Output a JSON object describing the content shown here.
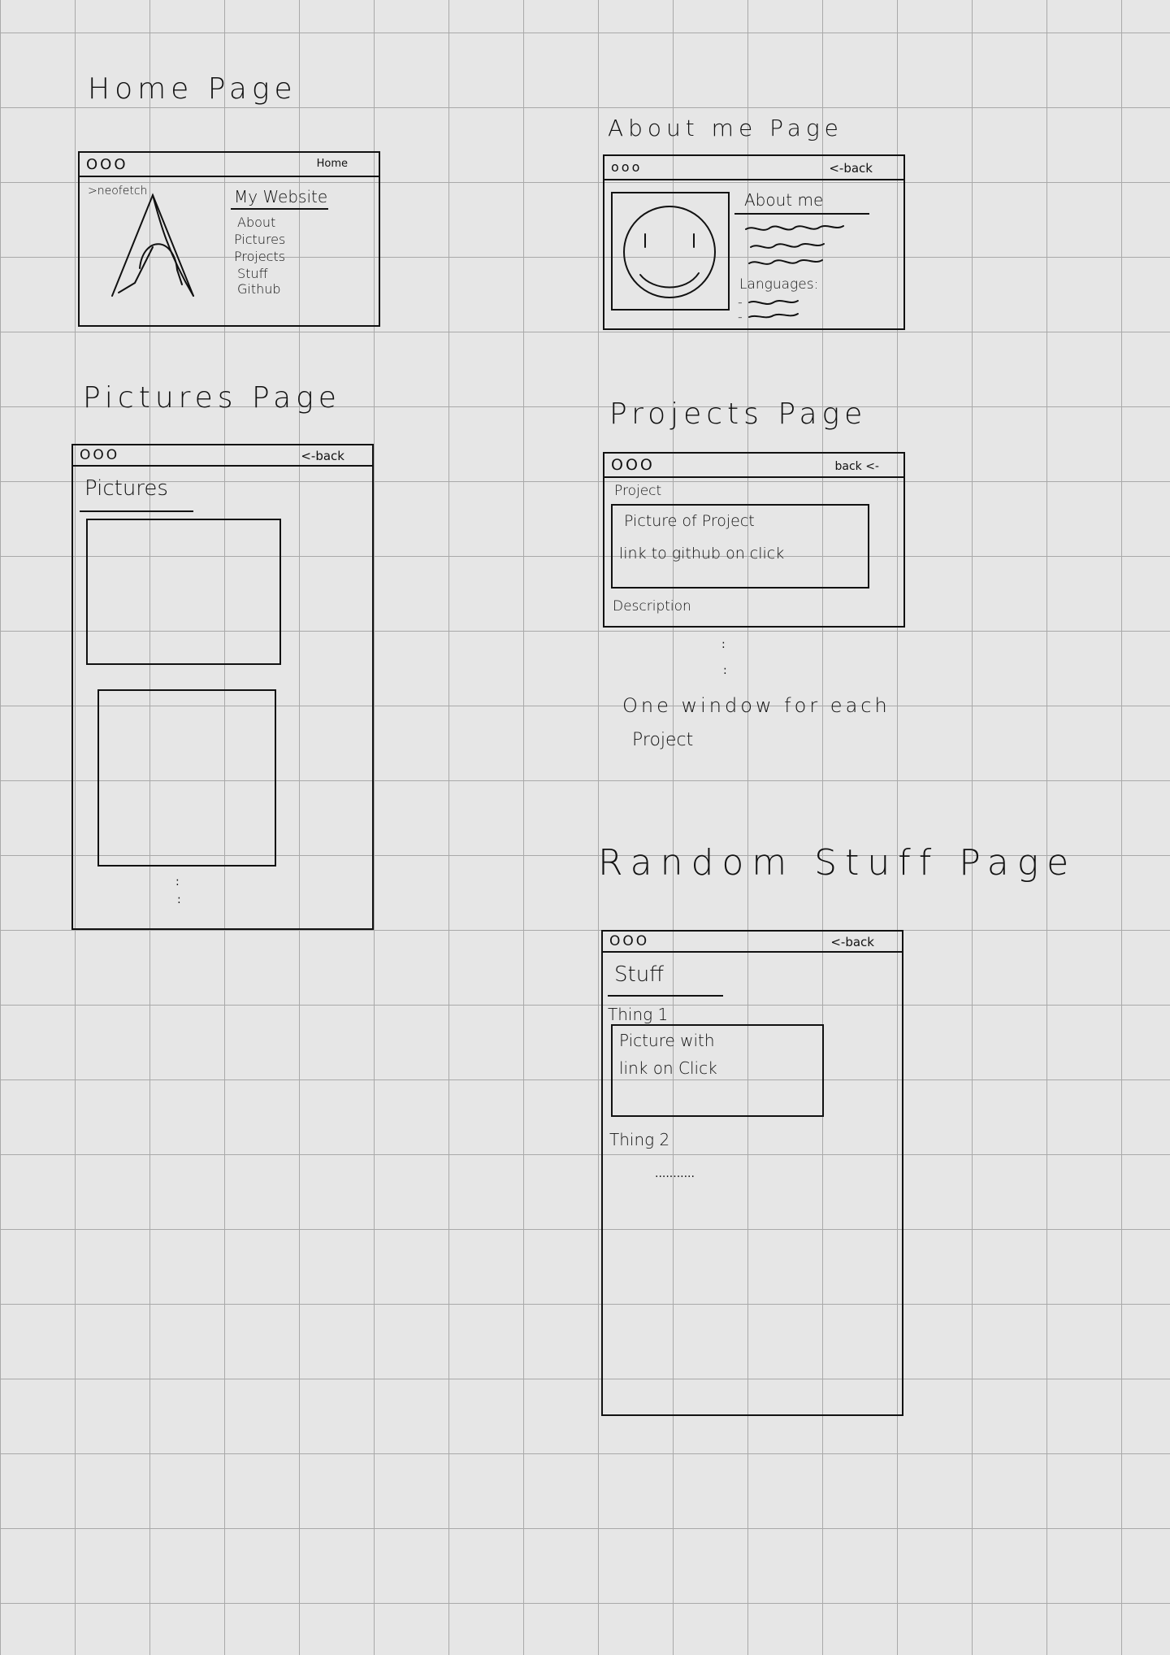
{
  "home": {
    "title": "Home Page",
    "dots": "OOO",
    "bar_label": "Home",
    "terminal": ">neofetch",
    "heading": "My Website",
    "links": [
      "About",
      "Pictures",
      "Projects",
      "Stuff",
      "Github"
    ]
  },
  "about": {
    "title": "About me Page",
    "dots": "ooo",
    "bar_label": "<-back",
    "heading": "About me",
    "languages_label": "Languages:",
    "bullets": [
      "-",
      "-"
    ]
  },
  "pictures": {
    "title": "Pictures Page",
    "dots": "OOO",
    "bar_label": "<-back",
    "heading": "Pictures",
    "more": ":"
  },
  "projects": {
    "title": "Projects Page",
    "dots": "OOO",
    "bar_label": "back <-",
    "section_label": "Project",
    "box_line1": "Picture of Project",
    "box_line2": "link to github on click",
    "description": "Description",
    "more": ":",
    "note_line1": "One window for each",
    "note_line2": "Project"
  },
  "stuff": {
    "title": "Random Stuff Page",
    "dots": "OOO",
    "bar_label": "<-back",
    "heading": "Stuff",
    "thing1": "Thing 1",
    "box_line1": "Picture with",
    "box_line2": "link on Click",
    "thing2": "Thing 2",
    "more": "..........."
  }
}
